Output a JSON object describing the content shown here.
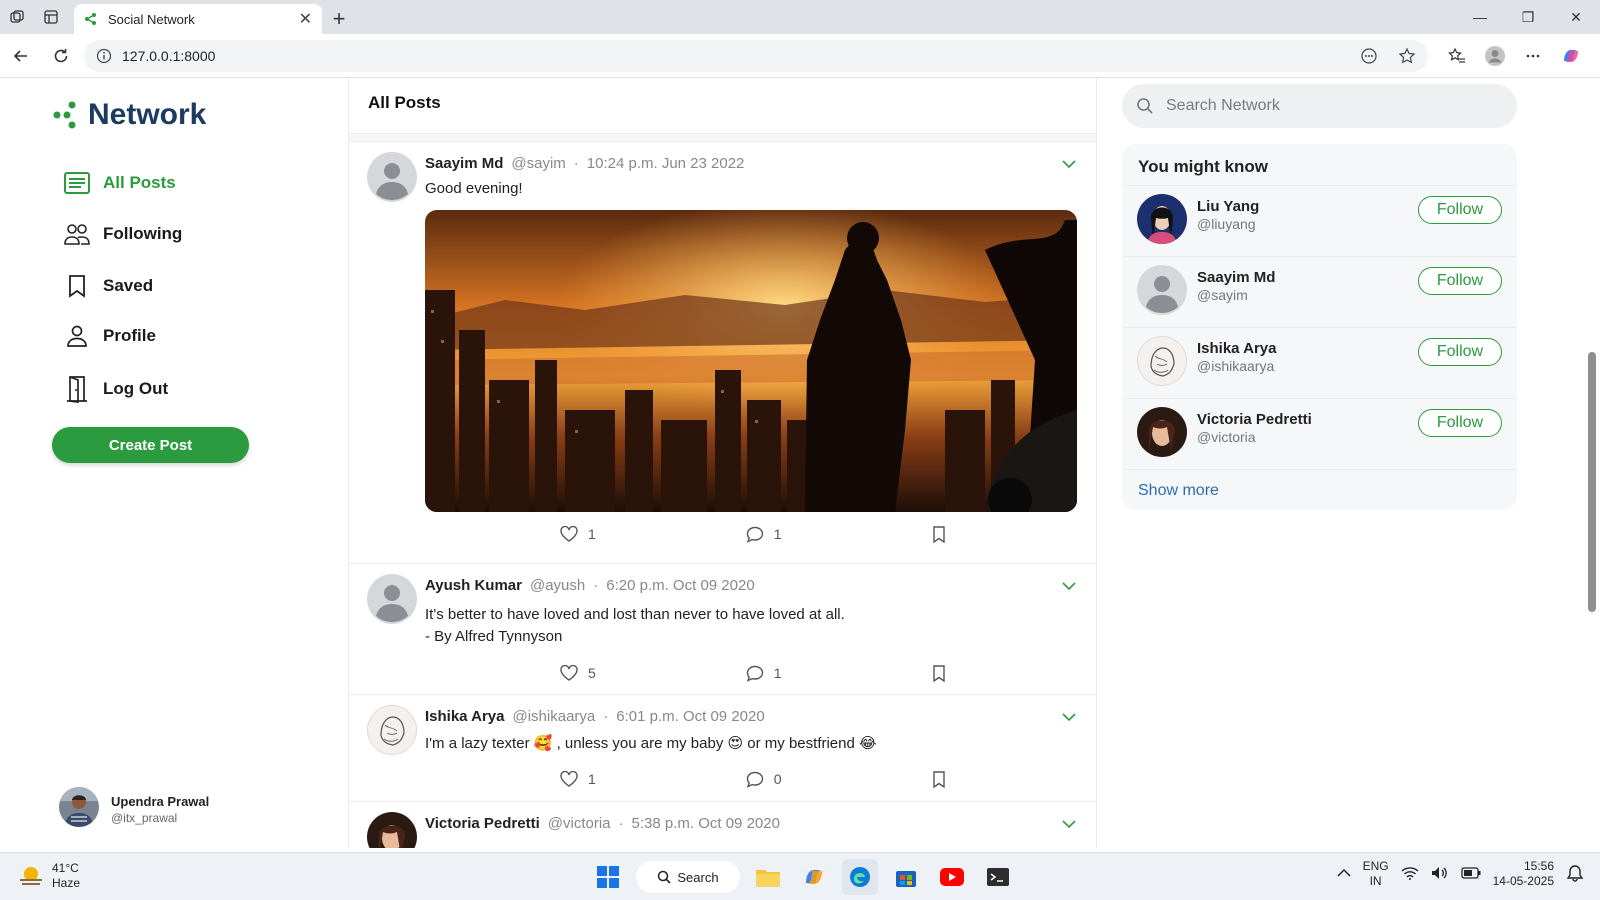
{
  "browser": {
    "tab_title": "Social Network",
    "url": "127.0.0.1:8000"
  },
  "brand": {
    "name": "Network",
    "color": "#1d3b60",
    "accent": "#2c9a3e"
  },
  "nav": {
    "items": [
      {
        "label": "All Posts",
        "icon": "list-icon",
        "active": true
      },
      {
        "label": "Following",
        "icon": "people-icon",
        "active": false
      },
      {
        "label": "Saved",
        "icon": "bookmark-icon",
        "active": false
      },
      {
        "label": "Profile",
        "icon": "person-icon",
        "active": false
      },
      {
        "label": "Log Out",
        "icon": "door-icon",
        "active": false
      }
    ],
    "create_label": "Create Post"
  },
  "current_user": {
    "name": "Upendra Prawal",
    "handle": "@itx_prawal"
  },
  "feed": {
    "title": "All Posts",
    "posts": [
      {
        "name": "Saayim Md",
        "handle": "@sayim",
        "time": "10:24 p.m. Jun 23 2022",
        "text": "Good evening!",
        "has_image": true,
        "likes": "1",
        "comments": "1"
      },
      {
        "name": "Ayush Kumar",
        "handle": "@ayush",
        "time": "6:20 p.m. Oct 09 2020",
        "text": "It's better to have loved and lost than never to have loved at all.",
        "text2": "- By Alfred Tynnyson",
        "likes": "5",
        "comments": "1"
      },
      {
        "name": "Ishika Arya",
        "handle": "@ishikaarya",
        "time": "6:01 p.m. Oct 09 2020",
        "text": "I'm a lazy texter 🥰 , unless you are my baby 😍 or my bestfriend 😂",
        "likes": "1",
        "comments": "0"
      },
      {
        "name": "Victoria Pedretti",
        "handle": "@victoria",
        "time": "5:38 p.m. Oct 09 2020"
      }
    ]
  },
  "search": {
    "placeholder": "Search Network"
  },
  "suggestions": {
    "title": "You might know",
    "follow_label": "Follow",
    "people": [
      {
        "name": "Liu Yang",
        "handle": "@liuyang"
      },
      {
        "name": "Saayim Md",
        "handle": "@sayim"
      },
      {
        "name": "Ishika Arya",
        "handle": "@ishikaarya"
      },
      {
        "name": "Victoria Pedretti",
        "handle": "@victoria"
      }
    ],
    "show_more": "Show more"
  },
  "taskbar": {
    "temp": "41°C",
    "weather": "Haze",
    "search_label": "Search",
    "lang1": "ENG",
    "lang2": "IN",
    "time": "15:56",
    "date": "14-05-2025"
  }
}
